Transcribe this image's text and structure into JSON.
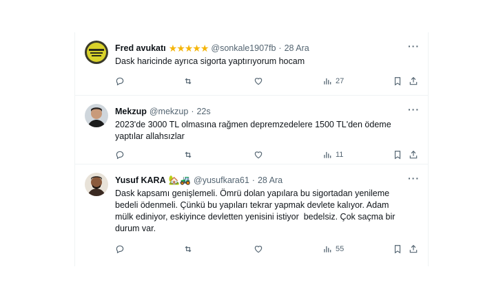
{
  "tweets": [
    {
      "name": "Fred avukatı",
      "stars": "★★★★★",
      "handle": "@sonkale1907fb",
      "separator": "·",
      "time": "28 Ara",
      "text": "Dask haricinde ayrıca sigorta yaptırıyorum hocam",
      "views": "27",
      "avatar_icon": "yellow-badge-avatar"
    },
    {
      "name": "Mekzup",
      "handle": "@mekzup",
      "separator": "·",
      "time": "22s",
      "text": "2023'de 3000 TL olmasına rağmen depremzedelere 1500 TL'den ödeme\nyaptılar allahsızlar",
      "views": "11",
      "avatar_icon": "man-portrait-avatar"
    },
    {
      "name": "Yusuf KARA",
      "emoji": "🏡🚜",
      "handle": "@yusufkara61",
      "separator": "·",
      "time": "28 Ara",
      "text": "Dask kapsamı genişlemeli. Ömrü dolan yapılara bu sigortadan yenileme\nbedeli ödenmeli. Çünkü bu yapıları tekrar yapmak devlete kalıyor. Adam\nmülk ediniyor, eskiyince devletten yenisini istiyor  bedelsiz. Çok saçma bir\ndurum var.",
      "views": "55",
      "avatar_icon": "man-portrait-avatar"
    }
  ],
  "more_label": "···",
  "colors": {
    "text": "#0f1419",
    "muted": "#536471",
    "divider": "#eff3f4",
    "star": "#f5b50a"
  }
}
